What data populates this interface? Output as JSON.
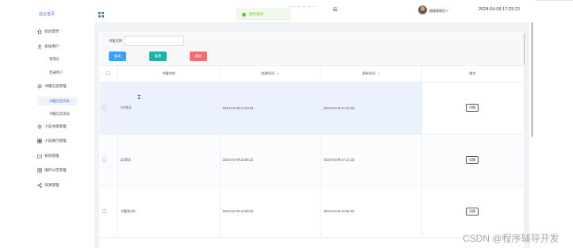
{
  "sidebar": {
    "title": "后台首页",
    "items": [
      {
        "label": "后台首页",
        "icon": "home-icon"
      },
      {
        "label": "系统用户",
        "icon": "user-icon"
      },
      {
        "label": "管理员",
        "sub": true
      },
      {
        "label": "普通用户",
        "sub": true
      },
      {
        "label": "书籍信息管理",
        "icon": "gear-icon"
      },
      {
        "label": "书籍信息列表",
        "sub": true,
        "active": true
      },
      {
        "label": "书籍信息添加",
        "sub": true
      },
      {
        "label": "小说书单管理",
        "icon": "gear-icon"
      },
      {
        "label": "小说排行管理",
        "icon": "grid-icon"
      },
      {
        "label": "系统管理",
        "icon": "folder-icon"
      },
      {
        "label": "组织公告管理",
        "icon": "table-icon"
      },
      {
        "label": "资源管理",
        "icon": "share-icon"
      }
    ]
  },
  "header": {
    "menu_icon": "menu-grid-icon",
    "partial_text": "— — — — — —",
    "code_text": "码",
    "toast": "操作成功!",
    "username": "超级管理员",
    "datetime": "2024-04-09 17:23:12"
  },
  "search": {
    "label": "书籍名称",
    "placeholder": "",
    "query_label": "查询",
    "reset_label": "重置",
    "delete_label": "删除"
  },
  "table": {
    "headers": {
      "name": "书籍名称",
      "created": "创建时间",
      "updated": "更新时间",
      "ops": "操作"
    },
    "rows": [
      {
        "name": "XX测试",
        "created": "2024-04-09 17:23:04",
        "updated": "2024-04-09 17:23:04",
        "op": "详情"
      },
      {
        "name": "ZZ测试",
        "created": "2024-04-09 16:58:32",
        "updated": "2024-04-09 17:14:15",
        "op": "详情"
      },
      {
        "name": "书籍测试C",
        "created": "2024-04-09 16:56:53",
        "updated": "2024-04-09 16:56:53",
        "op": "详情"
      }
    ]
  },
  "watermark": "CSDN @程序辅导开发",
  "colors": {
    "primary": "#409eff",
    "teal": "#20b2aa",
    "danger": "#f56c6c",
    "success": "#67c23a",
    "row_highlight": "#ecf2fd"
  }
}
